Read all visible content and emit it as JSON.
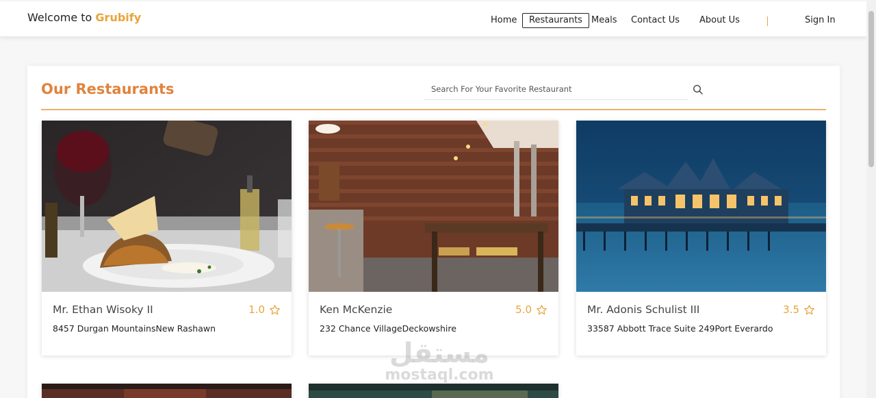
{
  "header": {
    "brand_prefix": "Welcome to ",
    "brand_name": "Grubify",
    "nav": {
      "home": "Home",
      "restaurants": "Restaurants",
      "meals": "Meals",
      "contact": "Contact Us",
      "about": "About Us",
      "divider": "|",
      "sign_in": "Sign In"
    }
  },
  "main": {
    "title": "Our Restaurants",
    "search_placeholder": "Search For Your Favorite Restaurant",
    "restaurants": [
      {
        "name": "Mr. Ethan Wisoky II",
        "rating": "1.0",
        "address": "8457 Durgan MountainsNew Rashawn",
        "image": "plated-lasagna-dish"
      },
      {
        "name": "Ken McKenzie",
        "rating": "5.0",
        "address": "232 Chance VillageDeckowshire",
        "image": "brick-wall-dining-interior"
      },
      {
        "name": "Mr. Adonis Schulist III",
        "rating": "3.5",
        "address": "33587 Abbott Trace Suite 249Port Everardo",
        "image": "pier-pavilion-at-dusk"
      }
    ]
  },
  "watermark": {
    "arabic": "مستقل",
    "latin": "mostaql.com"
  },
  "colors": {
    "accent": "#e9a43a",
    "title": "#e0833e",
    "rule": "#e9b06a"
  }
}
